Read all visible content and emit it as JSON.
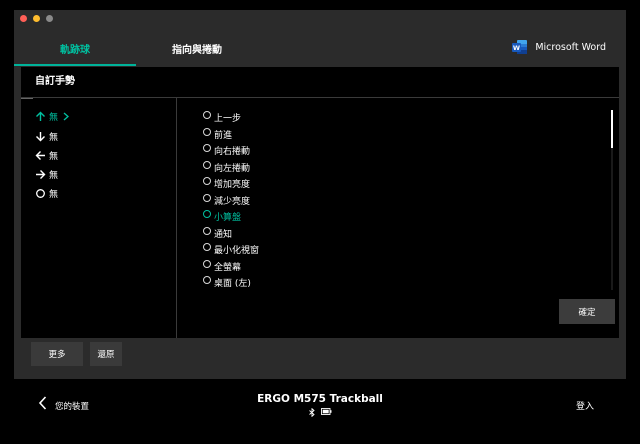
{
  "window": {
    "traffic_colors": [
      "#ff5f57",
      "#febc2e",
      "#8a8a8a"
    ]
  },
  "tabs": [
    {
      "label": "軌跡球",
      "active": true
    },
    {
      "label": "指向與捲動",
      "active": false
    }
  ],
  "app_selector": {
    "label": "Microsoft Word",
    "icon": "word-icon",
    "color": "#2b579a"
  },
  "panel": {
    "title": "自訂手勢",
    "directions": [
      {
        "icon": "arrow-up-icon",
        "label": "無",
        "active": true
      },
      {
        "icon": "arrow-down-icon",
        "label": "無",
        "active": false
      },
      {
        "icon": "arrow-left-icon",
        "label": "無",
        "active": false
      },
      {
        "icon": "arrow-right-icon",
        "label": "無",
        "active": false
      },
      {
        "icon": "circle-icon",
        "label": "無",
        "active": false
      }
    ],
    "options": [
      {
        "label": "上一步",
        "selected": false
      },
      {
        "label": "前進",
        "selected": false
      },
      {
        "label": "向右捲動",
        "selected": false
      },
      {
        "label": "向左捲動",
        "selected": false
      },
      {
        "label": "增加亮度",
        "selected": false
      },
      {
        "label": "減少亮度",
        "selected": false
      },
      {
        "label": "小算盤",
        "selected": true
      },
      {
        "label": "通知",
        "selected": false
      },
      {
        "label": "最小化視窗",
        "selected": false
      },
      {
        "label": "全螢幕",
        "selected": false
      },
      {
        "label": "桌面 (左)",
        "selected": false
      }
    ],
    "confirm_label": "確定"
  },
  "buttons": {
    "more_label": "更多",
    "restore_label": "還原"
  },
  "footer": {
    "back_label": "您的裝置",
    "device_name": "ERGO M575 Trackball",
    "login_label": "登入"
  },
  "colors": {
    "accent": "#00c0a0"
  }
}
